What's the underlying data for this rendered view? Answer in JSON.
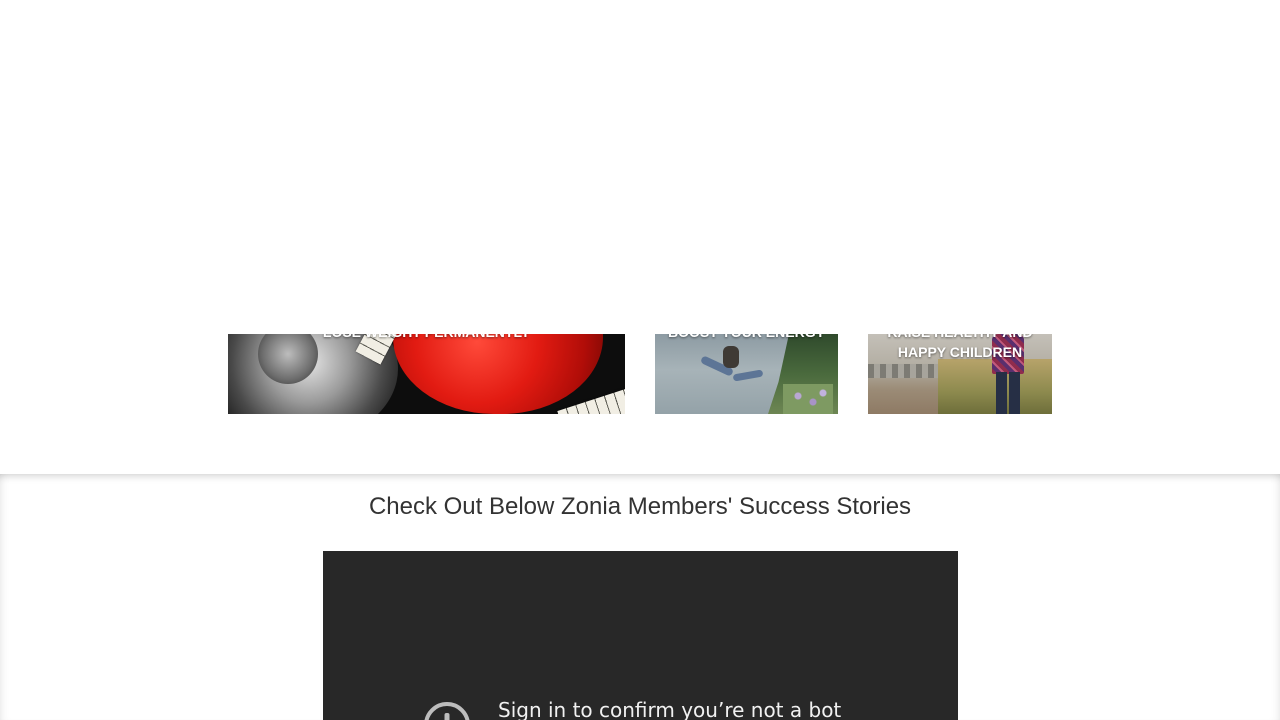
{
  "cards": [
    {
      "label": "LOSE WEIGHT PERMANENTLY"
    },
    {
      "label": "BOOST YOUR ENERGY"
    },
    {
      "label": "RAISE HEALTHY AND HAPPY CHILDREN"
    }
  ],
  "stories": {
    "title": "Check Out Below Zonia Members' Success Stories",
    "video": {
      "message": "Sign in to confirm you’re not a bot",
      "icon": "alert-icon"
    }
  },
  "colors": {
    "video_background": "#282828",
    "title_text": "#333333",
    "card_label": "#ffffff"
  }
}
